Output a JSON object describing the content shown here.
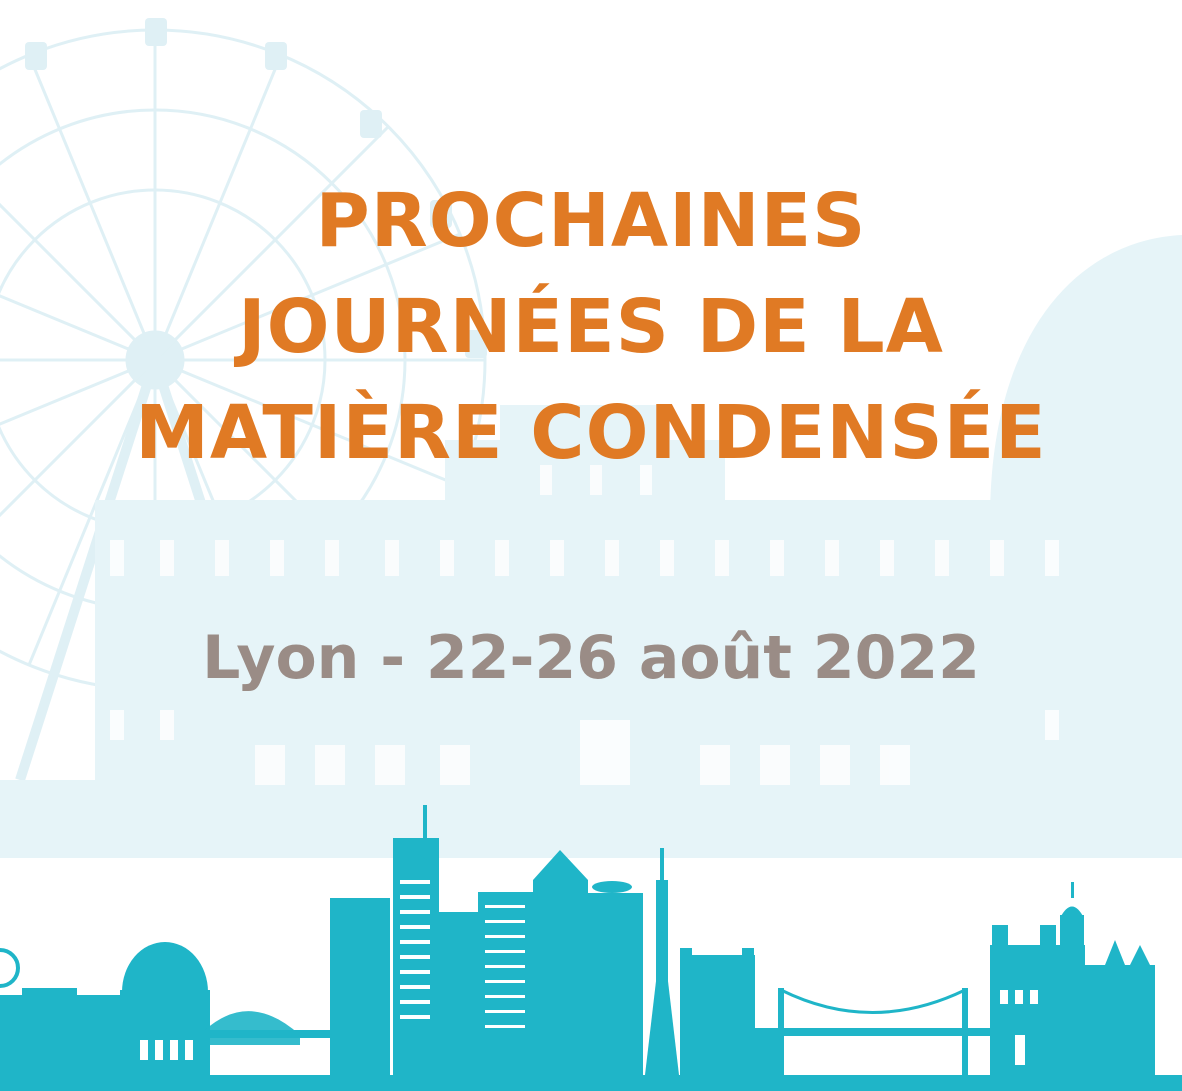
{
  "title": {
    "line1": "PROCHAINES",
    "line2": "JOURNÉES DE LA",
    "line3": "MATIÈRE CONDENSÉE"
  },
  "subtitle": "Lyon - 22-26 août 2022",
  "colors": {
    "title": "#e07a24",
    "subtitle": "#9a8c86",
    "skyline": "#1fb5c8",
    "background_skyline": "#e6f4f8"
  }
}
